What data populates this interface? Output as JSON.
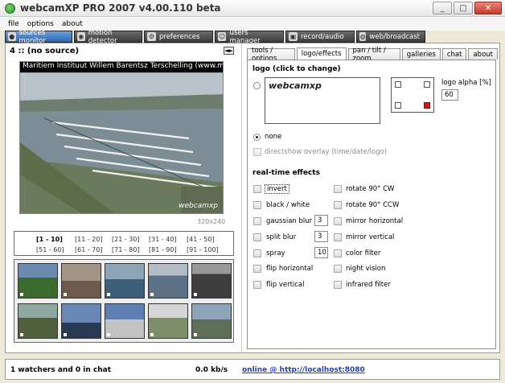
{
  "window": {
    "title": "webcamXP PRO 2007 v4.00.110 beta",
    "min": "_",
    "max": "□",
    "close": "✕"
  },
  "menu": [
    "file",
    "options",
    "about"
  ],
  "top_tabs": [
    {
      "label": "sources monitor",
      "icon": "camera-icon"
    },
    {
      "label": "motion detector",
      "icon": "motion-icon"
    },
    {
      "label": "preferences",
      "icon": "gear-icon"
    },
    {
      "label": "users manager",
      "icon": "users-icon"
    },
    {
      "label": "record/audio",
      "icon": "lock-icon"
    },
    {
      "label": "web/broadcast",
      "icon": "globe-icon"
    }
  ],
  "source": {
    "label": "4 :: (no source)",
    "arrows": "◄►",
    "caption": "Maritiem Instituut Willem Barentsz Terschelling (www.mi",
    "watermark": "webcamxp",
    "resolution": "320x240"
  },
  "pages": [
    "[1 - 10]",
    "[11 - 20]",
    "[21 - 30]",
    "[31 - 40]",
    "[41 - 50]",
    "[51 - 60]",
    "[61 - 70]",
    "[71 - 80]",
    "[81 - 90]",
    "[91 - 100]"
  ],
  "right_tabs": [
    "tools / options",
    "logo/effects",
    "pan / tilt / zoom",
    "galleries",
    "chat",
    "about"
  ],
  "logo": {
    "section_title": "logo (click to change)",
    "logo_text": "webcamxp",
    "alpha_label": "logo alpha [%]",
    "alpha_value": "60",
    "none_label": "none",
    "overlay_label": "directshow overlay (time/date/logo)"
  },
  "effects": {
    "title": "real-time effects",
    "left": [
      {
        "label": "invert",
        "value": ""
      },
      {
        "label": "black / white",
        "value": ""
      },
      {
        "label": "gaussian blur",
        "value": "3"
      },
      {
        "label": "split blur",
        "value": "3"
      },
      {
        "label": "spray",
        "value": "10"
      },
      {
        "label": "flip horizontal",
        "value": ""
      },
      {
        "label": "flip vertical",
        "value": ""
      }
    ],
    "right": [
      "rotate 90° CW",
      "rotate 90° CCW",
      "mirror horizontal",
      "mirror vertical",
      "color filter",
      "night vision",
      "infrared filter"
    ]
  },
  "status": {
    "watchers": "1 watchers and 0 in chat",
    "rate": "0.0 kb/s",
    "link": "online @ http://localhost:8080"
  }
}
